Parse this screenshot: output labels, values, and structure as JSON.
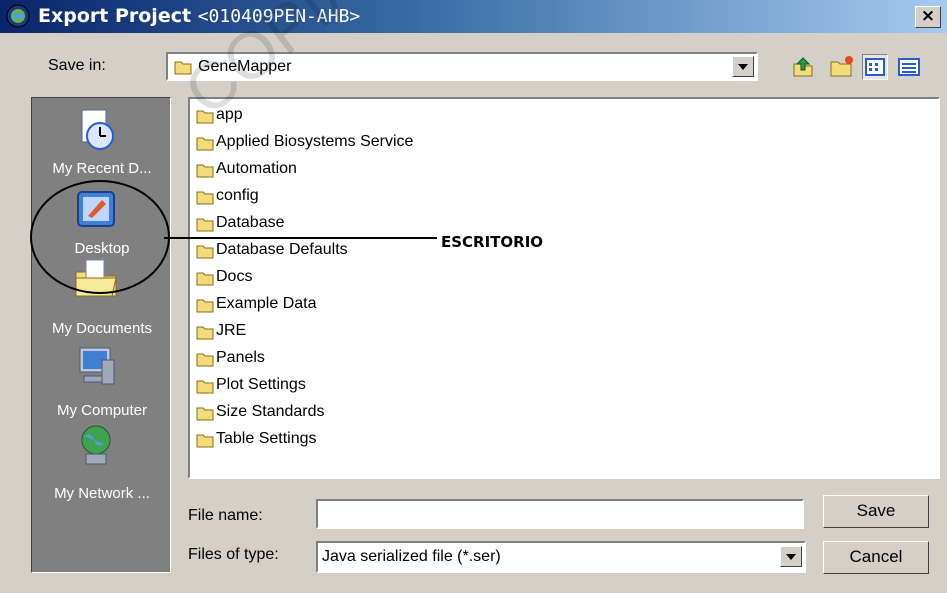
{
  "window": {
    "title": "Export Project",
    "subtitle": "<010409PEN-AHB>",
    "close_glyph": "×"
  },
  "save_in": {
    "label": "Save in:",
    "value": "GeneMapper"
  },
  "toolbar": {
    "icons": [
      "up-one-level-icon",
      "create-new-folder-icon",
      "list-view-icon",
      "details-view-icon"
    ]
  },
  "places": [
    {
      "label": "My Recent D...",
      "icon": "recent-documents-icon"
    },
    {
      "label": "Desktop",
      "icon": "desktop-icon"
    },
    {
      "label": "My Documents",
      "icon": "my-documents-icon"
    },
    {
      "label": "My Computer",
      "icon": "my-computer-icon"
    },
    {
      "label": "My Network ...",
      "icon": "my-network-icon"
    }
  ],
  "files": [
    {
      "name": "app"
    },
    {
      "name": "Applied Biosystems Service"
    },
    {
      "name": "Automation"
    },
    {
      "name": "config"
    },
    {
      "name": "Database"
    },
    {
      "name": "Database Defaults"
    },
    {
      "name": "Docs"
    },
    {
      "name": "Example Data"
    },
    {
      "name": "JRE"
    },
    {
      "name": "Panels"
    },
    {
      "name": "Plot Settings"
    },
    {
      "name": "Size Standards"
    },
    {
      "name": "Table Settings"
    }
  ],
  "filename": {
    "label": "File name:",
    "value": ""
  },
  "filetype": {
    "label": "Files of type:",
    "value": "Java serialized file (*.ser)"
  },
  "buttons": {
    "save": "Save",
    "cancel": "Cancel"
  },
  "annotation": {
    "text": "ESCRITORIO"
  },
  "watermark": {
    "text": "COPIA N"
  }
}
